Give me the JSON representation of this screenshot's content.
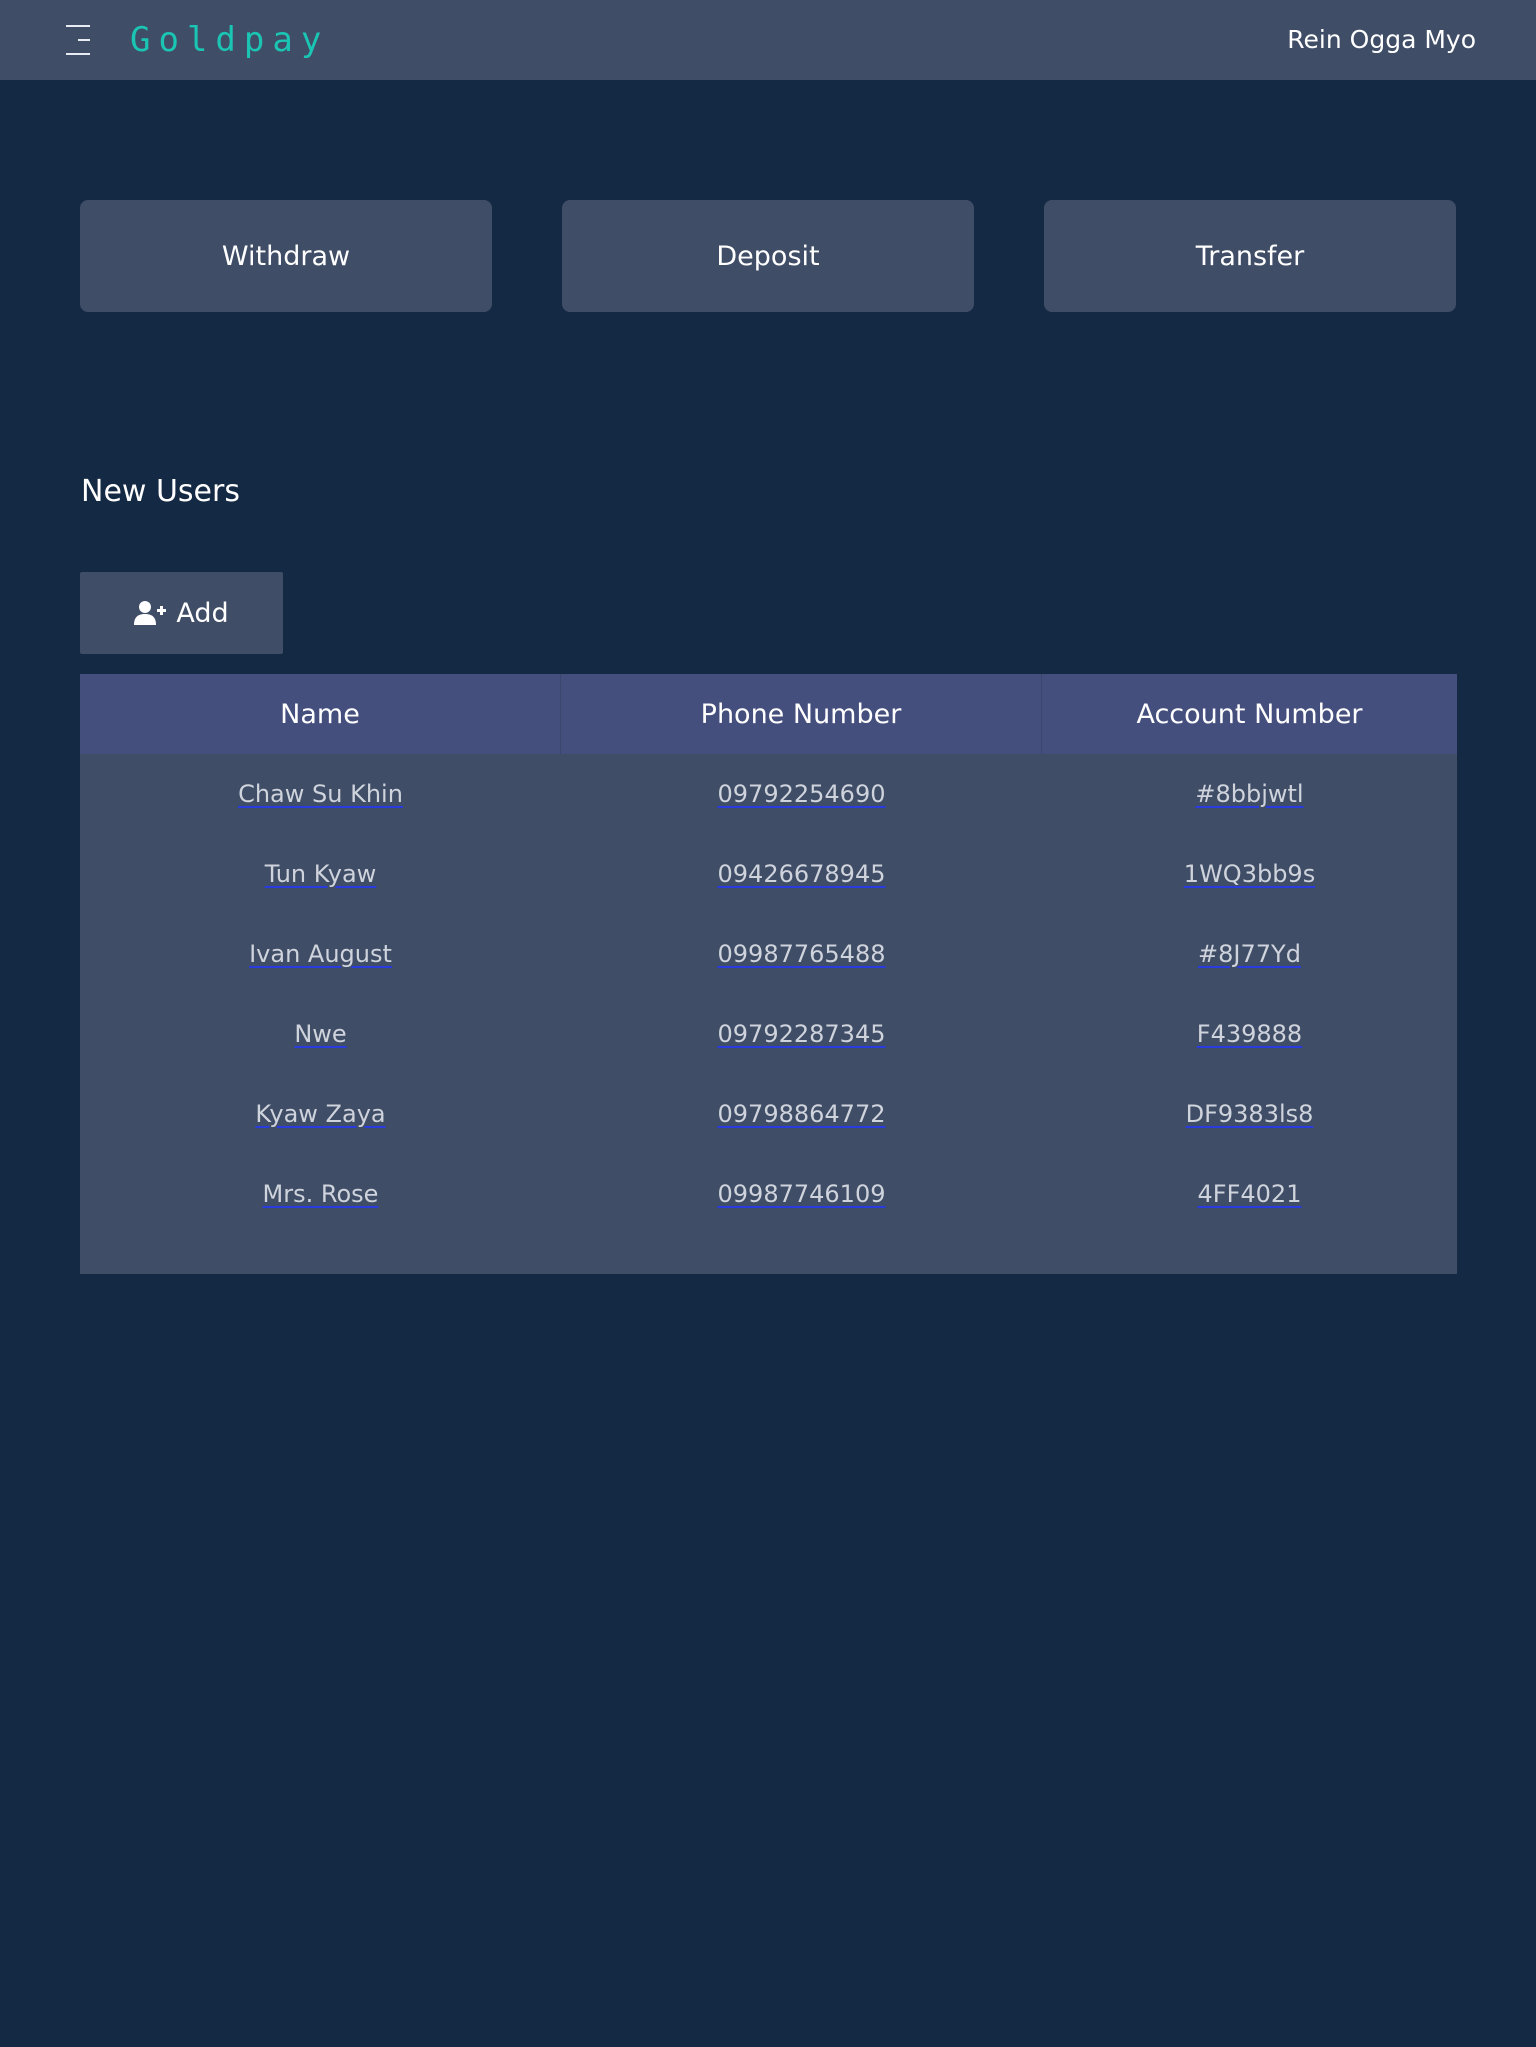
{
  "header": {
    "brand": "Goldpay",
    "user_name": "Rein Ogga Myo",
    "menu_icon": "hamburger-menu-icon"
  },
  "actions": {
    "withdraw": "Withdraw",
    "deposit": "Deposit",
    "transfer": "Transfer"
  },
  "new_users": {
    "title": "New Users",
    "add_label": "Add",
    "add_icon": "user-plus-icon",
    "columns": [
      "Name",
      "Phone Number",
      "Account Number"
    ],
    "rows": [
      {
        "name": "Chaw Su Khin",
        "phone": "09792254690",
        "account": "#8bbjwtl"
      },
      {
        "name": "Tun Kyaw",
        "phone": "09426678945",
        "account": "1WQ3bb9s"
      },
      {
        "name": "Ivan August",
        "phone": "09987765488",
        "account": "#8J77Yd"
      },
      {
        "name": "Nwe",
        "phone": "09792287345",
        "account": "F439888"
      },
      {
        "name": "Kyaw Zaya",
        "phone": "09798864772",
        "account": "DF9383ls8"
      },
      {
        "name": "Mrs. Rose",
        "phone": "09987746109",
        "account": "4FF4021"
      }
    ]
  },
  "colors": {
    "background": "#142943",
    "panel": "#3f4d67",
    "table_header": "#454f7e",
    "brand_accent": "#1bc5b3",
    "link_underline": "#2a3ce0"
  }
}
